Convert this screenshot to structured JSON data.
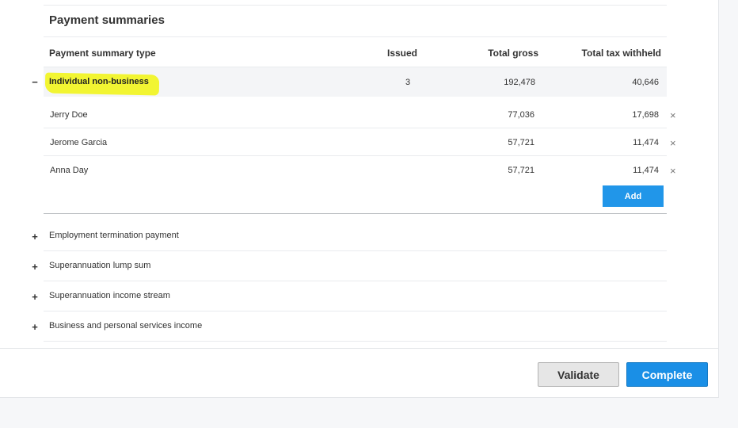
{
  "section": {
    "title": "Payment summaries"
  },
  "table": {
    "headers": {
      "type": "Payment summary type",
      "issued": "Issued",
      "total_gross": "Total gross",
      "total_tax": "Total tax withheld"
    },
    "expanded_group": {
      "label": "Individual non-business",
      "issued": "3",
      "total_gross": "192,478",
      "total_tax": "40,646",
      "toggle": "−",
      "rows": [
        {
          "name": "Jerry Doe",
          "gross": "77,036",
          "tax": "17,698",
          "remove": "×"
        },
        {
          "name": "Jerome Garcia",
          "gross": "57,721",
          "tax": "11,474",
          "remove": "×"
        },
        {
          "name": "Anna Day",
          "gross": "57,721",
          "tax": "11,474",
          "remove": "×"
        }
      ],
      "add_label": "Add"
    },
    "collapsed_groups": [
      {
        "label": "Employment termination payment",
        "toggle": "+"
      },
      {
        "label": "Superannuation lump sum",
        "toggle": "+"
      },
      {
        "label": "Superannuation income stream",
        "toggle": "+"
      },
      {
        "label": "Business and personal services income",
        "toggle": "+"
      }
    ]
  },
  "footer": {
    "validate_label": "Validate",
    "complete_label": "Complete"
  },
  "colors": {
    "highlight": "#f2f532",
    "primary": "#1a8fe6",
    "secondary": "#e6e6e6"
  }
}
